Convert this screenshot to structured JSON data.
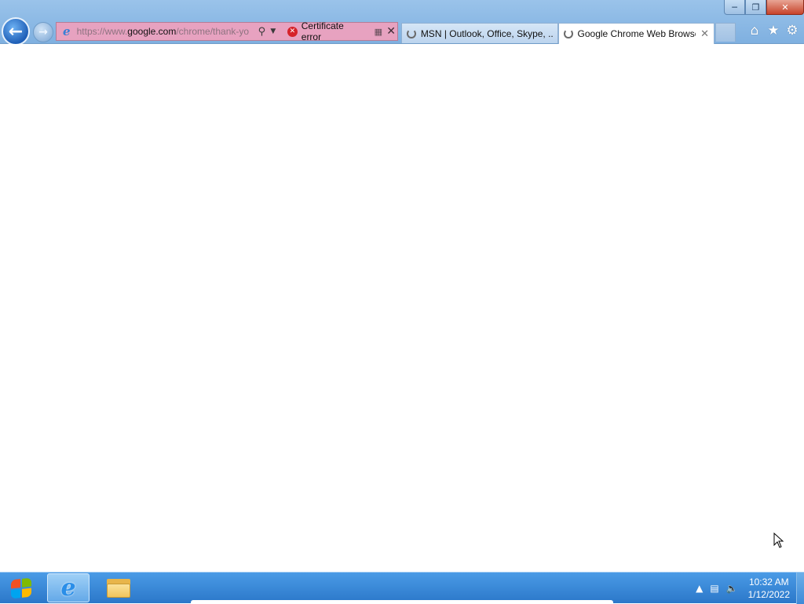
{
  "window": {
    "minimize_icon": "minimize-icon",
    "restore_icon": "restore-icon",
    "close_icon": "close-icon"
  },
  "address_bar": {
    "url_prefix": "https://www.",
    "url_host": "google.com",
    "url_suffix": "/chrome/thank-yo",
    "certificate_label": "Certificate error",
    "bg_color": "#e7a2c0"
  },
  "tabs": [
    {
      "label": "MSN | Outlook, Office, Skype, ...",
      "active": false,
      "loading": true
    },
    {
      "label": "Google Chrome Web Browser",
      "active": true,
      "loading": true
    }
  ],
  "toolbar": {
    "home_icon": "home-icon",
    "favorites_icon": "star-icon",
    "tools_icon": "gear-icon"
  },
  "taskbar": {
    "apps": [
      "internet-explorer",
      "file-explorer"
    ],
    "clock_time": "10:32 AM",
    "clock_date": "1/12/2022"
  }
}
